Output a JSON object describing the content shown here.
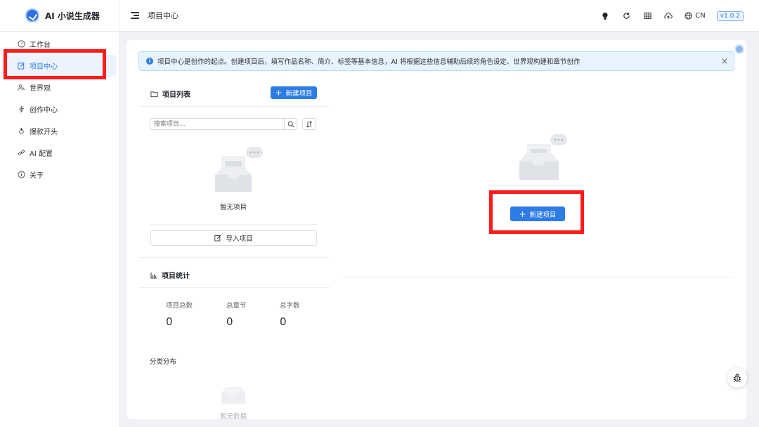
{
  "app": {
    "title": "AI 小说生成器"
  },
  "header": {
    "page_title": "项目中心",
    "lang_label": "CN",
    "version": "v1.0.2",
    "icons": [
      "lightbulb-icon",
      "refresh-icon",
      "table-icon",
      "cloud-icon",
      "globe-icon"
    ]
  },
  "sidebar": {
    "items": [
      {
        "label": "工作台",
        "icon": "dashboard-icon",
        "active": false
      },
      {
        "label": "项目中心",
        "icon": "edit-icon",
        "active": true
      },
      {
        "label": "世界观",
        "icon": "people-icon",
        "active": false
      },
      {
        "label": "创作中心",
        "icon": "lightning-icon",
        "active": false
      },
      {
        "label": "爆款开头",
        "icon": "fire-icon",
        "active": false
      },
      {
        "label": "AI 配置",
        "icon": "link-icon",
        "active": false
      },
      {
        "label": "关于",
        "icon": "info-icon",
        "active": false
      }
    ]
  },
  "alert": {
    "text": "项目中心是创作的起点。创建项目后，填写作品名称、简介、标签等基本信息，AI 将根据这些信息辅助后续的角色设定、世界观构建和章节创作"
  },
  "project_list": {
    "title": "项目列表",
    "new_button": "新建项目",
    "search_placeholder": "搜索项目...",
    "empty_text": "暂无项目",
    "import_button": "导入项目"
  },
  "project_stats": {
    "title": "项目统计",
    "items": [
      {
        "label": "项目总数",
        "value": "0"
      },
      {
        "label": "总章节",
        "value": "0"
      },
      {
        "label": "总字数",
        "value": "0"
      }
    ],
    "distribution_label": "分类分布",
    "distribution_empty": "暂无数据"
  },
  "right_panel": {
    "new_button": "新建项目"
  },
  "colors": {
    "primary": "#2d7be5",
    "alert_bg": "#e7f3ff",
    "annotation_red": "#ff1a1a"
  }
}
